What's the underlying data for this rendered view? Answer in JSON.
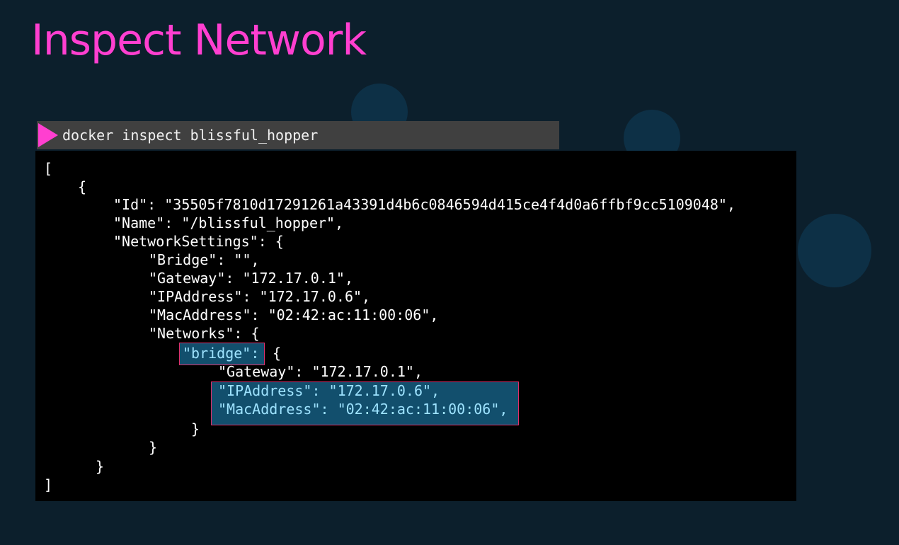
{
  "slide": {
    "title": "Inspect Network"
  },
  "command": {
    "text": "docker inspect blissful_hopper"
  },
  "output": {
    "l1": "[",
    "l2": "{",
    "l3": "\"Id\": \"35505f7810d17291261a43391d4b6c0846594d415ce4f4d0a6ffbf9cc5109048\",",
    "l4": "\"Name\": \"/blissful_hopper\",",
    "l5": "\"NetworkSettings\": {",
    "l6": "\"Bridge\": \"\",",
    "l7": "\"Gateway\": \"172.17.0.1\",",
    "l8": "\"IPAddress\": \"172.17.0.6\",",
    "l9": "\"MacAddress\": \"02:42:ac:11:00:06\",",
    "l10": "\"Networks\": {",
    "l11_key": "\"bridge\":",
    "l11_rest": " {",
    "l12": "\"Gateway\": \"172.17.0.1\",",
    "l13": "\"IPAddress\": \"172.17.0.6\",",
    "l14": "\"MacAddress\": \"02:42:ac:11:00:06\",",
    "l15": "}",
    "l16": "}",
    "l17": "}",
    "l18": "]"
  },
  "colors": {
    "background": "#0c1f2c",
    "title": "#ff3fd0",
    "highlight_bg": "#124f6d",
    "highlight_text": "#9ee3ff",
    "highlight_border": "#e0306c"
  }
}
